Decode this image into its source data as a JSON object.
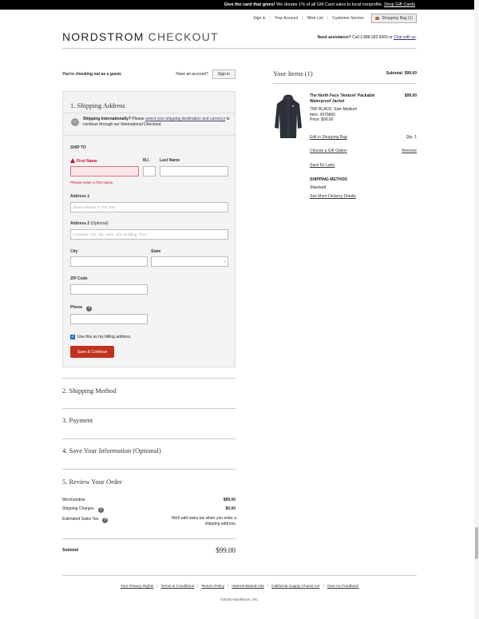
{
  "promo": {
    "lead": "Give the card that gives!",
    "text": " We donate 1% of all Gift Card sales to local nonprofits. ",
    "link": "Shop Gift Cards"
  },
  "nav": {
    "sign_in": "Sign in",
    "your_account": "Your Account",
    "wish_list": "Wish List",
    "customer_service": "Customer Service",
    "bag": "Shopping Bag (1)"
  },
  "logo": {
    "brand": "NORDSTROM",
    "suffix": "CHECKOUT"
  },
  "assist": {
    "lead": "Need assistance?",
    "call": " Call 1.888.282.6060 or ",
    "chat": "Chat with us"
  },
  "guest": {
    "text": "You're checking out as a guest.",
    "have_account": "Have an account?",
    "sign_in": "Sign in"
  },
  "shipping": {
    "title": "1. Shipping Address",
    "intl_lead": "Shipping Internationally?",
    "intl_pre": " Please ",
    "intl_link": "select your shipping destination and currency",
    "intl_post": " to continue through our International Checkout.",
    "ship_to": "SHIP TO",
    "first_name": "First Name",
    "mi": "M.I.",
    "last_name": "Last Name",
    "first_name_error": "Please enter a first name.",
    "address1": "Address 1",
    "address1_placeholder": "Street Address or P.O. Box",
    "address2": "Address 2",
    "address2_optional": "(Optional)",
    "address2_placeholder": "Company, C/O, Apt, Suite, Unit, Building, Floor",
    "city": "City",
    "state": "State",
    "zip": "ZIP Code",
    "phone": "Phone",
    "billing_checkbox": "Use this as my billing address.",
    "billing_checked": true,
    "save_button": "Save & Continue"
  },
  "sections": {
    "shipping_method": "2. Shipping Method",
    "payment": "3. Payment",
    "save_info": "4. Save Your Information (Optional)",
    "review": "5. Review Your Order"
  },
  "summary": {
    "merch_label": "Merchandise",
    "merch_value": "$99.00",
    "ship_label": "Shipping Charges",
    "ship_value": "$0.00",
    "tax_label": "Estimated Sales Tax",
    "tax_note": "We'll add sales tax when you enter a shipping address.",
    "subtotal_label": "Subtotal",
    "subtotal_value": "$99.00"
  },
  "items": {
    "title": "Your Items (1)",
    "subtotal": "Subtotal: $99.00",
    "product_name": "The North Face 'Venture' Packable Waterproof Jacket",
    "price": "$99.00",
    "variant": "TNF BLACK, Size Medium",
    "item_no": "Item:  #979660",
    "price_line": "Price:  $99.00",
    "edit_link": "Edit in Shopping Bag",
    "qty": "Qty:  1",
    "gift_link": "Choose a Gift Option",
    "remove_link": "Remove",
    "save_later": "Save for Later",
    "method_label": "SHIPPING METHOD",
    "method_value": "Standard",
    "more_delivery": "See More Delivery Details"
  },
  "footer": {
    "links": [
      "Your Privacy Rights",
      "Terms & Conditions",
      "Return Policy",
      "Interest-Based Ads",
      "California Supply Chains Act",
      "Give Us Feedback"
    ],
    "copyright": "©2016 Nordstrom, Inc."
  },
  "colors": {
    "accent": "#c0321d",
    "error": "#c8102e",
    "panel": "#f3f3f3"
  }
}
